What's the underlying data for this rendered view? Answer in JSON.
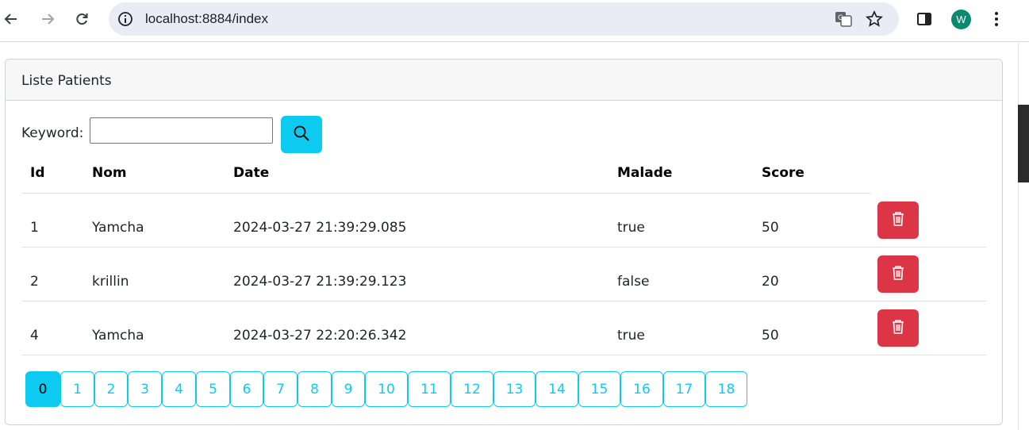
{
  "browser": {
    "url": "localhost:8884/index",
    "avatar_letter": "W"
  },
  "card": {
    "title": "Liste Patients"
  },
  "search": {
    "label": "Keyword:",
    "value": ""
  },
  "table": {
    "headers": [
      "Id",
      "Nom",
      "Date",
      "Malade",
      "Score"
    ],
    "rows": [
      {
        "id": "1",
        "nom": "Yamcha",
        "date": "2024-03-27 21:39:29.085",
        "malade": "true",
        "score": "50"
      },
      {
        "id": "2",
        "nom": "krillin",
        "date": "2024-03-27 21:39:29.123",
        "malade": "false",
        "score": "20"
      },
      {
        "id": "4",
        "nom": "Yamcha",
        "date": "2024-03-27 22:20:26.342",
        "malade": "true",
        "score": "50"
      }
    ]
  },
  "pagination": {
    "pages": [
      "0",
      "1",
      "2",
      "3",
      "4",
      "5",
      "6",
      "7",
      "8",
      "9",
      "10",
      "11",
      "12",
      "13",
      "14",
      "15",
      "16",
      "17",
      "18"
    ],
    "current": "0"
  },
  "colors": {
    "info": "#0dcaf0",
    "danger": "#dc3545"
  }
}
